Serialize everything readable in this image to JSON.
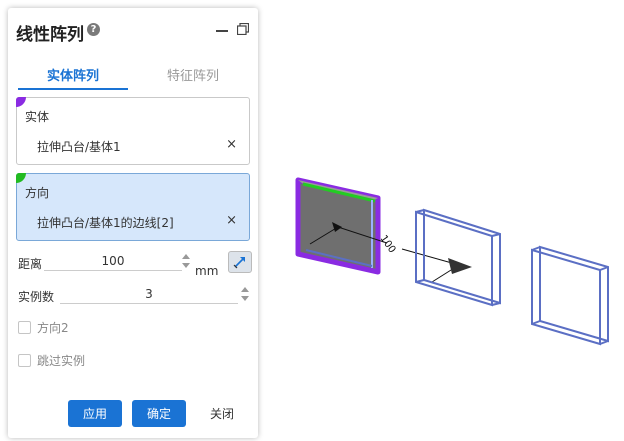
{
  "panel": {
    "title": "线性阵列",
    "help_glyph": "?",
    "tabs": [
      {
        "label": "实体阵列",
        "active": true
      },
      {
        "label": "特征阵列",
        "active": false
      }
    ]
  },
  "bodies": {
    "label": "实体",
    "item": "拉伸凸台/基体1",
    "remove_glyph": "×",
    "marker_color": "#8a2be2"
  },
  "direction": {
    "label": "方向",
    "item": "拉伸凸台/基体1的边线[2]",
    "remove_glyph": "×",
    "marker_color": "#22bb22"
  },
  "distance": {
    "label": "距离",
    "value": "100",
    "unit": "mm"
  },
  "instances": {
    "label": "实例数",
    "value": "3"
  },
  "direction2": {
    "label": "方向2",
    "checked": false
  },
  "skip": {
    "label": "跳过实例",
    "checked": false
  },
  "buttons": {
    "apply": "应用",
    "ok": "确定",
    "close": "关闭"
  },
  "viewport": {
    "dimension_label": "100"
  },
  "colors": {
    "accent": "#1a73d4",
    "selected_body": "#8a2be2",
    "edge_highlight": "#22cc22",
    "preview": "#5b6fc4"
  }
}
